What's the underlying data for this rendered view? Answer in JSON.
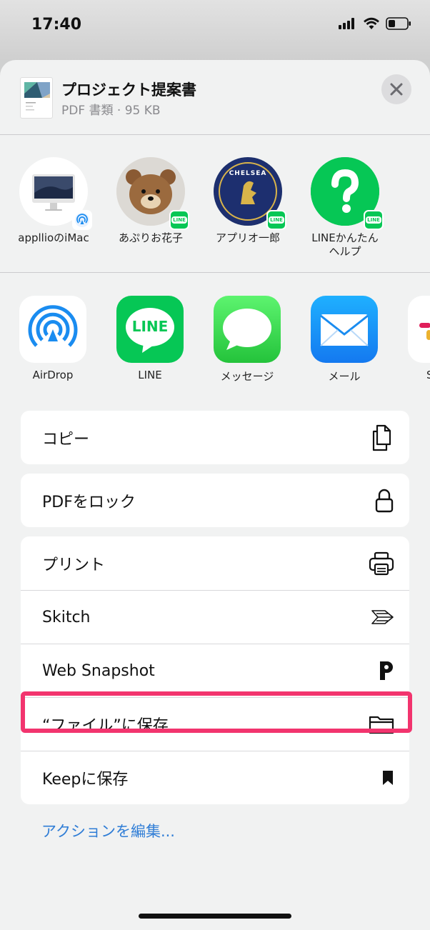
{
  "status_bar": {
    "time": "17:40"
  },
  "document": {
    "title": "プロジェクト提案書",
    "subtitle": "PDF 書類 · 95 KB"
  },
  "contacts": [
    {
      "label_line1": "appllioのiMac",
      "label_line2": ""
    },
    {
      "label_line1": "あぷりお花子",
      "label_line2": ""
    },
    {
      "label_line1": "アプリオ一郎",
      "label_line2": ""
    },
    {
      "label_line1": "LINEかんたん",
      "label_line2": "ヘルプ"
    }
  ],
  "contact_badge_text": "LINE",
  "chelsea_text": "CHELSEA",
  "apps": [
    {
      "label": "AirDrop"
    },
    {
      "label": "LINE",
      "icon_text": "LINE"
    },
    {
      "label": "メッセージ"
    },
    {
      "label": "メール"
    },
    {
      "label": "S"
    }
  ],
  "actions": {
    "copy": "コピー",
    "lock_pdf": "PDFをロック",
    "print": "プリント",
    "skitch": "Skitch",
    "web_snapshot": "Web Snapshot",
    "save_to_files": "“ファイル”に保存",
    "save_to_keep": "Keepに保存"
  },
  "edit_actions": "アクションを編集...",
  "colors": {
    "highlight": "#f2346e",
    "link": "#2f7dd6",
    "line_green": "#06c755"
  },
  "icons": {
    "copy": "copy-icon",
    "lock": "lock-icon",
    "print": "printer-icon",
    "skitch": "skitch-arrow-icon",
    "web_snapshot": "p-logo-icon",
    "files": "folder-icon",
    "keep": "bookmark-icon",
    "close": "close-icon"
  }
}
